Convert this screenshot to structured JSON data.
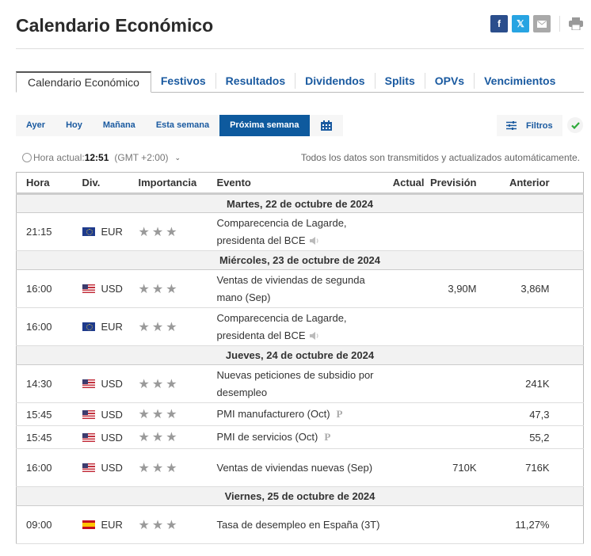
{
  "page": {
    "title": "Calendario Económico"
  },
  "share": {
    "facebook": "f",
    "twitter": "𝕏",
    "email": "email-icon",
    "print": "print-icon"
  },
  "tabs": [
    {
      "label": "Calendario Económico",
      "active": true
    },
    {
      "label": "Festivos"
    },
    {
      "label": "Resultados"
    },
    {
      "label": "Dividendos"
    },
    {
      "label": "Splits"
    },
    {
      "label": "OPVs"
    },
    {
      "label": "Vencimientos"
    }
  ],
  "day_filters": [
    {
      "label": "Ayer"
    },
    {
      "label": "Hoy"
    },
    {
      "label": "Mañana"
    },
    {
      "label": "Esta semana"
    },
    {
      "label": "Próxima semana",
      "active": true
    }
  ],
  "filters_label": "Filtros",
  "time_info": {
    "label": "Hora actual:",
    "time": "12:51",
    "timezone": "(GMT +2:00)"
  },
  "auto_update_note": "Todos los datos son transmitidos y actualizados automáticamente.",
  "table": {
    "headers": {
      "time": "Hora",
      "currency": "Div.",
      "importance": "Importancia",
      "event": "Evento",
      "actual": "Actual",
      "forecast": "Previsión",
      "previous": "Anterior"
    },
    "days": [
      {
        "date": "Martes, 22 de octubre de 2024",
        "events": [
          {
            "time": "21:15",
            "currency": "EUR",
            "flag": "eu",
            "importance": 3,
            "event": "Comparecencia de Lagarde, presidenta del BCE",
            "speech": true,
            "actual": "",
            "forecast": "",
            "previous": ""
          }
        ]
      },
      {
        "date": "Miércoles, 23 de octubre de 2024",
        "events": [
          {
            "time": "16:00",
            "currency": "USD",
            "flag": "us",
            "importance": 3,
            "event": "Ventas de viviendas de segunda mano (Sep)",
            "actual": "",
            "forecast": "3,90M",
            "previous": "3,86M"
          },
          {
            "time": "16:00",
            "currency": "EUR",
            "flag": "eu",
            "importance": 3,
            "event": "Comparecencia de Lagarde, presidenta del BCE",
            "speech": true,
            "actual": "",
            "forecast": "",
            "previous": ""
          }
        ]
      },
      {
        "date": "Jueves, 24 de octubre de 2024",
        "events": [
          {
            "time": "14:30",
            "currency": "USD",
            "flag": "us",
            "importance": 3,
            "event": "Nuevas peticiones de subsidio por desempleo",
            "actual": "",
            "forecast": "",
            "previous": "241K"
          },
          {
            "time": "15:45",
            "currency": "USD",
            "flag": "us",
            "importance": 3,
            "event": "PMI manufacturero (Oct)",
            "preliminary": "P",
            "actual": "",
            "forecast": "",
            "previous": "47,3"
          },
          {
            "time": "15:45",
            "currency": "USD",
            "flag": "us",
            "importance": 3,
            "event": "PMI de servicios (Oct)",
            "preliminary": "P",
            "actual": "",
            "forecast": "",
            "previous": "55,2"
          },
          {
            "time": "16:00",
            "currency": "USD",
            "flag": "us",
            "importance": 3,
            "event": "Ventas de viviendas nuevas (Sep)",
            "actual": "",
            "forecast": "710K",
            "previous": "716K"
          }
        ]
      },
      {
        "date": "Viernes, 25 de octubre de 2024",
        "events": [
          {
            "time": "09:00",
            "currency": "EUR",
            "flag": "es",
            "importance": 3,
            "event": "Tasa de desempleo en España (3T)",
            "actual": "",
            "forecast": "",
            "previous": "11,27%"
          }
        ]
      }
    ]
  },
  "colors": {
    "accent": "#0e5a9e",
    "link": "#1a5aa0",
    "facebook": "#2b4e8c",
    "twitter": "#28a4e2",
    "check": "#2eaa3a"
  }
}
